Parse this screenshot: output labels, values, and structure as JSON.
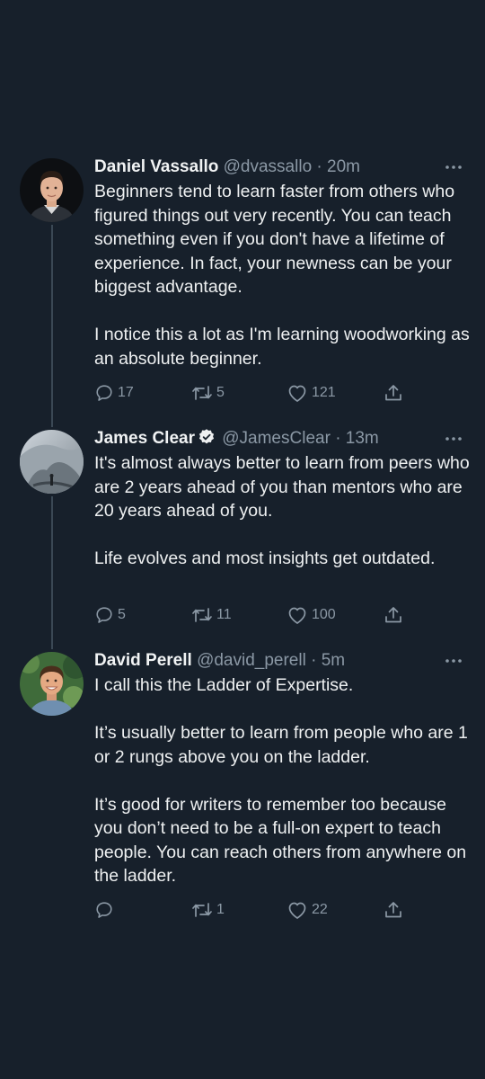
{
  "tweets": [
    {
      "name": "Daniel Vassallo",
      "handle": "@dvassallo",
      "separator": "·",
      "time": "20m",
      "verified": false,
      "paragraphs": [
        "Beginners tend to learn faster from others who figured things out very recently. You can teach something even if you don't have a lifetime of experience. In fact, your newness can be your biggest advantage.",
        "I notice this a lot as I'm learning woodworking as an absolute beginner."
      ],
      "replies": "17",
      "retweets": "5",
      "likes": "121"
    },
    {
      "name": "James Clear",
      "handle": "@JamesClear",
      "separator": "·",
      "time": "13m",
      "verified": true,
      "paragraphs": [
        "It's almost always better to learn from peers who are 2 years ahead of you than mentors who are 20 years ahead of you.",
        "Life evolves and most insights get outdated."
      ],
      "replies": "5",
      "retweets": "11",
      "likes": "100"
    },
    {
      "name": "David Perell",
      "handle": "@david_perell",
      "separator": "·",
      "time": "5m",
      "verified": false,
      "paragraphs": [
        "I call this the Ladder of Expertise.",
        "It’s usually better to learn from people who are 1 or 2 rungs above you on the ladder.",
        "It’s good for writers to remember too because you don’t need to be a full-on expert to teach people. You can reach others from anywhere on the ladder."
      ],
      "replies": "",
      "retweets": "1",
      "likes": "22"
    }
  ],
  "icons": {
    "reply": "reply-icon",
    "retweet": "retweet-icon",
    "like": "heart-icon",
    "share": "share-icon",
    "more": "more-icon",
    "verified": "verified-badge-icon"
  },
  "colors": {
    "background": "#17202b",
    "text": "#e7e9ea",
    "secondary": "#8b98a5",
    "thread_line": "#3b4855"
  }
}
